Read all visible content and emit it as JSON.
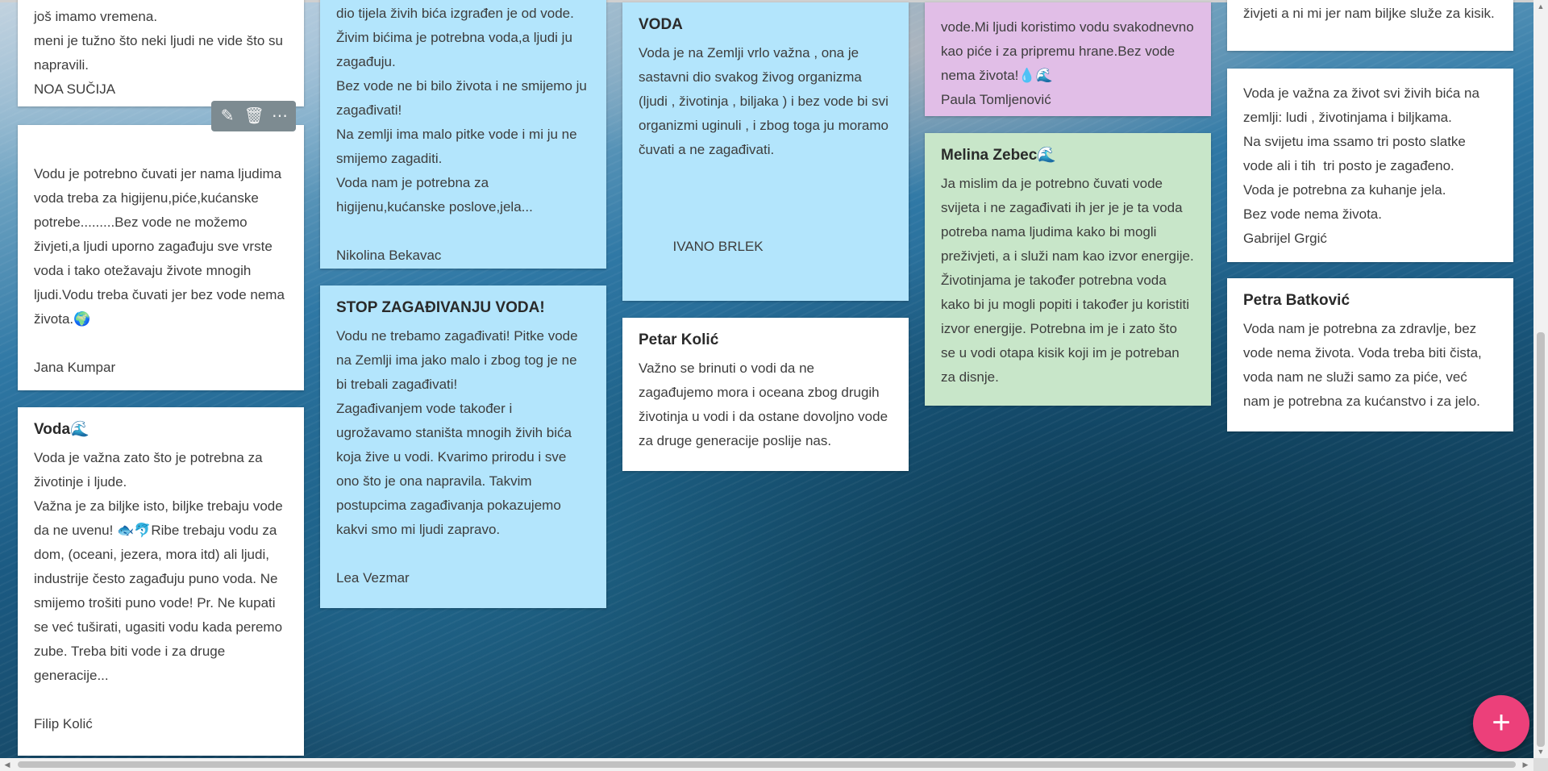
{
  "board": {
    "cards": [
      {
        "id": "c1",
        "title": "",
        "body": "još imamo vremena.\nmeni je tužno što neki ljudi ne vide što su napravili.\nNOA SUČIJA"
      },
      {
        "id": "c2",
        "title": "",
        "body": "Vodu je potrebno čuvati jer nama ljudima voda treba za higijenu,piće,kućanske potrebe.........Bez vode ne možemo živjeti,a ljudi uporno zagađuju sve vrste voda i tako otežavaju živote mnogih ljudi.Vodu treba čuvati jer bez vode nema života.🌍\n\nJana Kumpar"
      },
      {
        "id": "c3",
        "title": "Voda🌊",
        "body": "Voda je važna zato što je potrebna za životinje i ljude.\nVažna je za biljke isto, biljke trebaju vode da ne uvenu! 🐟🐬Ribe trebaju vodu za dom, (oceani, jezera, mora itd) ali ljudi, industrije često zagađuju puno voda. Ne smijemo trošiti puno vode! Pr. Ne kupati se već tuširati, ugasiti vodu kada peremo zube. Treba biti vode i za druge generacije...\n\nFilip Kolić"
      },
      {
        "id": "c4",
        "title": "",
        "body": "dio tijela živih bića izgrađen je od vode.\nŽivim bićima je potrebna voda,a ljudi ju zagađuju.\nBez vode ne bi bilo života i ne smijemo ju zagađivati!\nNa zemlji ima malo pitke vode i mi ju ne smijemo zagaditi.\nVoda nam je potrebna za higijenu,kućanske poslove,jela...\n\nNikolina Bekavac"
      },
      {
        "id": "c5",
        "title": "STOP ZAGAĐIVANJU VODA!",
        "body": "Vodu ne trebamo zagađivati! Pitke vode na Zemlji ima jako malo i zbog tog je ne bi trebali zagađivati!\nZagađivanjem vode također i ugrožavamo staništa mnogih živih bića koja žive u vodi. Kvarimo prirodu i sve ono što je ona napravila. Takvim postupcima zagađivanja pokazujemo kakvi smo mi ljudi zapravo.\n\nLea Vezmar"
      },
      {
        "id": "c6",
        "title": "VODA",
        "body": "Voda je na Zemlji vrlo važna , ona je sastavni dio svakog živog organizma (ljudi , životinja , biljaka ) i bez vode bi svi organizmi uginuli , i zbog toga ju moramo čuvati a ne zagađivati.\n\n\n\n         IVANO BRLEK"
      },
      {
        "id": "c7",
        "title": "Petar Kolić",
        "body": "Važno se brinuti o vodi da ne zagađujemo mora i oceana zbog drugih životinja u vodi i da ostane dovoljno vode za druge generacije poslije nas."
      },
      {
        "id": "c8",
        "title": "",
        "body": "vode.Mi ljudi koristimo vodu svakodnevno kao piće i za pripremu hrane.Bez vode nema života!💧🌊\nPaula Tomljenović"
      },
      {
        "id": "c9",
        "title": "Melina Zebec🌊",
        "body": "Ja mislim da je potrebno čuvati vode svijeta i ne zagađivati ih jer je je ta voda potreba nama ljudima kako bi mogli preživjeti, a i služi nam kao izvor energije. Životinjama je također potrebna voda kako bi ju mogli popiti i također ju koristiti izvor energije. Potrebna im je i zato što se u vodi otapa kisik koji im je potreban za disnje."
      },
      {
        "id": "c10",
        "title": "",
        "body": "živjeti a ni mi jer nam biljke služe za kisik."
      },
      {
        "id": "c11",
        "title": "",
        "body": "Voda je važna za život svi živih bića na zemlji: ludi , životinjama i biljkama.\nNa svijetu ima ssamo tri posto slatke vode ali i tih  tri posto je zagađeno.\nVoda je potrebna za kuhanje jela.\nBez vode nema života.\nGabrijel Grgić"
      },
      {
        "id": "c12",
        "title": "Petra Batković",
        "body": "Voda nam je potrebna za zdravlje, bez vode nema života. Voda treba biti čista, voda nam ne služi samo za piće, već nam je potrebna za kućanstvo i za jelo."
      }
    ]
  },
  "toolbar": {
    "edit_icon": "pencil-icon",
    "delete_icon": "trash-icon",
    "more_icon": "more-horizontal-icon"
  },
  "fab": {
    "icon": "plus-icon",
    "label": "+"
  },
  "colors": {
    "card_white": "#ffffff",
    "card_blue": "#b3e5fc",
    "card_purple": "#e1bee7",
    "card_green": "#c8e6c9",
    "fab": "#ec407a"
  }
}
